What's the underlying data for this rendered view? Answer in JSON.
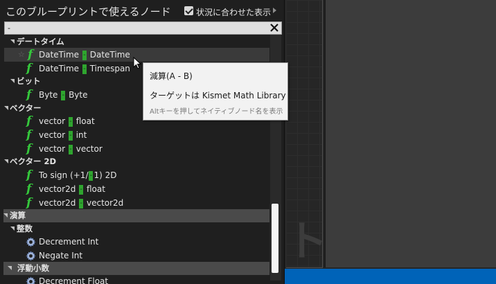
{
  "palette": {
    "title": "このブループリントで使えるノード",
    "context_sensitive_label": "状況に合わせた表示",
    "search": {
      "value": "-",
      "placeholder": ""
    }
  },
  "categories": {
    "datetime": "デートタイム",
    "bit": "ビット",
    "vector": "ベクター",
    "vector2d": "ベクター 2D",
    "math": "演算",
    "integer": "整数",
    "float": "浮動小数"
  },
  "items": {
    "datetime_datetime": {
      "a": "DateTime",
      "op": "-",
      "b": "DateTime"
    },
    "datetime_timespan": {
      "a": "DateTime",
      "op": "-",
      "b": "Timespan"
    },
    "byte_byte": {
      "a": "Byte",
      "op": "-",
      "b": "Byte"
    },
    "vector_float": {
      "a": "vector",
      "op": "-",
      "b": "float"
    },
    "vector_int": {
      "a": "vector",
      "op": "-",
      "b": "int"
    },
    "vector_vector": {
      "a": "vector",
      "op": "-",
      "b": "vector"
    },
    "to_sign": {
      "a": "To sign (+1/",
      "op": "-",
      "b": "1) 2D"
    },
    "vector2d_float": {
      "a": "vector2d",
      "op": "-",
      "b": "float"
    },
    "vector2d_vector2d": {
      "a": "vector2d",
      "op": "-",
      "b": "vector2d"
    },
    "decrement_int": "Decrement Int",
    "negate_int": "Negate Int",
    "decrement_float": "Decrement Float"
  },
  "tooltip": {
    "title": "減算(A - B)",
    "target": "ターゲットは Kismet Math Library",
    "hint": "Altキーを押してネイティブノード名を表示"
  },
  "background": {
    "watermark": "ト"
  },
  "icons": {
    "function": "f",
    "gear": "gear-icon",
    "clear": "close-icon",
    "check": "checkbox-checked-icon"
  },
  "colors": {
    "function_icon": "#35c83c",
    "operator_bg": "#2fa52f",
    "taskbar": "#0063b8",
    "tooltip_bg": "#f2f2f2"
  }
}
